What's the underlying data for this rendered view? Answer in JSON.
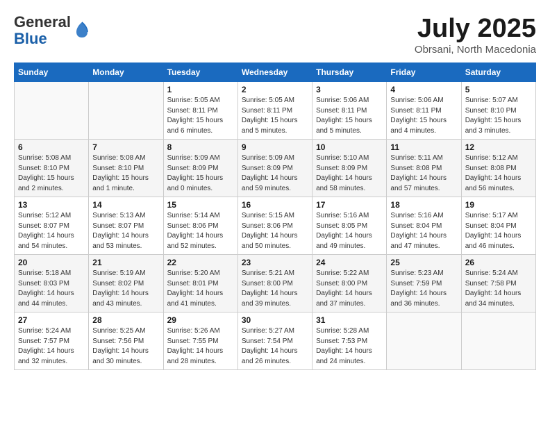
{
  "header": {
    "logo_general": "General",
    "logo_blue": "Blue",
    "month_title": "July 2025",
    "location": "Obrsani, North Macedonia"
  },
  "days_of_week": [
    "Sunday",
    "Monday",
    "Tuesday",
    "Wednesday",
    "Thursday",
    "Friday",
    "Saturday"
  ],
  "weeks": [
    [
      {
        "day": "",
        "info": ""
      },
      {
        "day": "",
        "info": ""
      },
      {
        "day": "1",
        "info": "Sunrise: 5:05 AM\nSunset: 8:11 PM\nDaylight: 15 hours\nand 6 minutes."
      },
      {
        "day": "2",
        "info": "Sunrise: 5:05 AM\nSunset: 8:11 PM\nDaylight: 15 hours\nand 5 minutes."
      },
      {
        "day": "3",
        "info": "Sunrise: 5:06 AM\nSunset: 8:11 PM\nDaylight: 15 hours\nand 5 minutes."
      },
      {
        "day": "4",
        "info": "Sunrise: 5:06 AM\nSunset: 8:11 PM\nDaylight: 15 hours\nand 4 minutes."
      },
      {
        "day": "5",
        "info": "Sunrise: 5:07 AM\nSunset: 8:10 PM\nDaylight: 15 hours\nand 3 minutes."
      }
    ],
    [
      {
        "day": "6",
        "info": "Sunrise: 5:08 AM\nSunset: 8:10 PM\nDaylight: 15 hours\nand 2 minutes."
      },
      {
        "day": "7",
        "info": "Sunrise: 5:08 AM\nSunset: 8:10 PM\nDaylight: 15 hours\nand 1 minute."
      },
      {
        "day": "8",
        "info": "Sunrise: 5:09 AM\nSunset: 8:09 PM\nDaylight: 15 hours\nand 0 minutes."
      },
      {
        "day": "9",
        "info": "Sunrise: 5:09 AM\nSunset: 8:09 PM\nDaylight: 14 hours\nand 59 minutes."
      },
      {
        "day": "10",
        "info": "Sunrise: 5:10 AM\nSunset: 8:09 PM\nDaylight: 14 hours\nand 58 minutes."
      },
      {
        "day": "11",
        "info": "Sunrise: 5:11 AM\nSunset: 8:08 PM\nDaylight: 14 hours\nand 57 minutes."
      },
      {
        "day": "12",
        "info": "Sunrise: 5:12 AM\nSunset: 8:08 PM\nDaylight: 14 hours\nand 56 minutes."
      }
    ],
    [
      {
        "day": "13",
        "info": "Sunrise: 5:12 AM\nSunset: 8:07 PM\nDaylight: 14 hours\nand 54 minutes."
      },
      {
        "day": "14",
        "info": "Sunrise: 5:13 AM\nSunset: 8:07 PM\nDaylight: 14 hours\nand 53 minutes."
      },
      {
        "day": "15",
        "info": "Sunrise: 5:14 AM\nSunset: 8:06 PM\nDaylight: 14 hours\nand 52 minutes."
      },
      {
        "day": "16",
        "info": "Sunrise: 5:15 AM\nSunset: 8:06 PM\nDaylight: 14 hours\nand 50 minutes."
      },
      {
        "day": "17",
        "info": "Sunrise: 5:16 AM\nSunset: 8:05 PM\nDaylight: 14 hours\nand 49 minutes."
      },
      {
        "day": "18",
        "info": "Sunrise: 5:16 AM\nSunset: 8:04 PM\nDaylight: 14 hours\nand 47 minutes."
      },
      {
        "day": "19",
        "info": "Sunrise: 5:17 AM\nSunset: 8:04 PM\nDaylight: 14 hours\nand 46 minutes."
      }
    ],
    [
      {
        "day": "20",
        "info": "Sunrise: 5:18 AM\nSunset: 8:03 PM\nDaylight: 14 hours\nand 44 minutes."
      },
      {
        "day": "21",
        "info": "Sunrise: 5:19 AM\nSunset: 8:02 PM\nDaylight: 14 hours\nand 43 minutes."
      },
      {
        "day": "22",
        "info": "Sunrise: 5:20 AM\nSunset: 8:01 PM\nDaylight: 14 hours\nand 41 minutes."
      },
      {
        "day": "23",
        "info": "Sunrise: 5:21 AM\nSunset: 8:00 PM\nDaylight: 14 hours\nand 39 minutes."
      },
      {
        "day": "24",
        "info": "Sunrise: 5:22 AM\nSunset: 8:00 PM\nDaylight: 14 hours\nand 37 minutes."
      },
      {
        "day": "25",
        "info": "Sunrise: 5:23 AM\nSunset: 7:59 PM\nDaylight: 14 hours\nand 36 minutes."
      },
      {
        "day": "26",
        "info": "Sunrise: 5:24 AM\nSunset: 7:58 PM\nDaylight: 14 hours\nand 34 minutes."
      }
    ],
    [
      {
        "day": "27",
        "info": "Sunrise: 5:24 AM\nSunset: 7:57 PM\nDaylight: 14 hours\nand 32 minutes."
      },
      {
        "day": "28",
        "info": "Sunrise: 5:25 AM\nSunset: 7:56 PM\nDaylight: 14 hours\nand 30 minutes."
      },
      {
        "day": "29",
        "info": "Sunrise: 5:26 AM\nSunset: 7:55 PM\nDaylight: 14 hours\nand 28 minutes."
      },
      {
        "day": "30",
        "info": "Sunrise: 5:27 AM\nSunset: 7:54 PM\nDaylight: 14 hours\nand 26 minutes."
      },
      {
        "day": "31",
        "info": "Sunrise: 5:28 AM\nSunset: 7:53 PM\nDaylight: 14 hours\nand 24 minutes."
      },
      {
        "day": "",
        "info": ""
      },
      {
        "day": "",
        "info": ""
      }
    ]
  ]
}
